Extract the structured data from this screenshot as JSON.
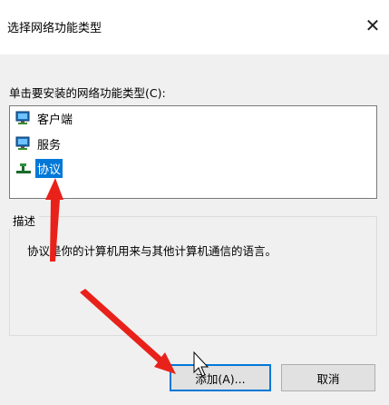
{
  "dialog": {
    "title": "选择网络功能类型",
    "close_symbol": "✕"
  },
  "prompt": "单击要安装的网络功能类型(C):",
  "list": {
    "items": [
      {
        "label": "客户端",
        "icon": "client-computer-icon",
        "selected": false
      },
      {
        "label": "服务",
        "icon": "service-computer-icon",
        "selected": false
      },
      {
        "label": "协议",
        "icon": "protocol-network-icon",
        "selected": true
      }
    ]
  },
  "description_group": {
    "title": "描述",
    "text": "协议是你的计算机用来与其他计算机通信的语言。"
  },
  "buttons": {
    "add": "添加(A)...",
    "cancel": "取消"
  },
  "annotations": {
    "arrow_color": "#e8221b",
    "icons": [
      "red-arrow-icon",
      "mouse-cursor-icon"
    ]
  }
}
